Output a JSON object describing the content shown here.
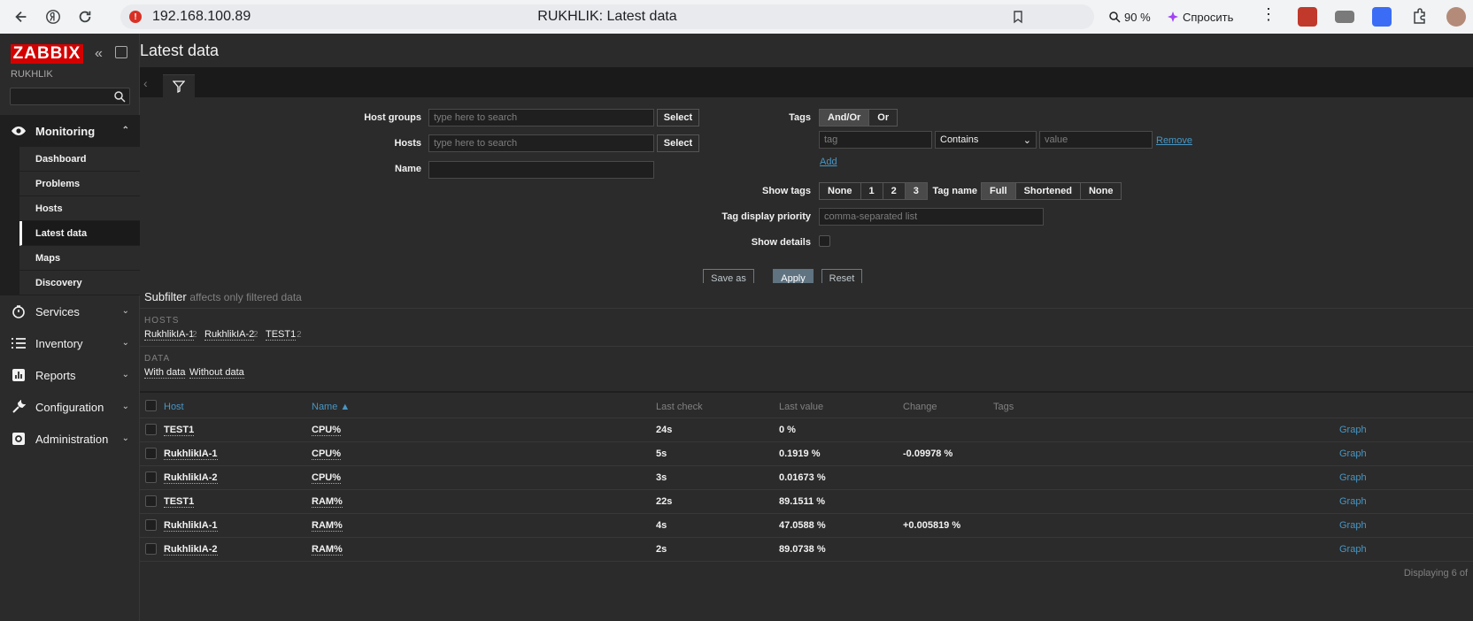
{
  "browser": {
    "url": "192.168.100.89",
    "title": "RUKHLIK: Latest data",
    "zoom": "90 %",
    "ask_label": "Спросить"
  },
  "sidebar": {
    "logo": "ZABBIX",
    "server": "RUKHLIK",
    "menu": [
      {
        "label": "Monitoring",
        "icon": "eye-icon",
        "open": true,
        "items": [
          "Dashboard",
          "Problems",
          "Hosts",
          "Latest data",
          "Maps",
          "Discovery"
        ],
        "active": "Latest data"
      },
      {
        "label": "Services",
        "icon": "stopwatch-icon"
      },
      {
        "label": "Inventory",
        "icon": "list-icon"
      },
      {
        "label": "Reports",
        "icon": "bar-chart-icon"
      },
      {
        "label": "Configuration",
        "icon": "wrench-icon"
      },
      {
        "label": "Administration",
        "icon": "gear-icon"
      }
    ]
  },
  "page": {
    "title": "Latest data"
  },
  "filter": {
    "host_groups_label": "Host groups",
    "host_groups_placeholder": "type here to search",
    "hosts_label": "Hosts",
    "hosts_placeholder": "type here to search",
    "name_label": "Name",
    "select_label": "Select",
    "tags_label": "Tags",
    "tags_andor": "And/Or",
    "tags_or": "Or",
    "tag_placeholder": "tag",
    "operator": "Contains",
    "value_placeholder": "value",
    "remove_label": "Remove",
    "add_label": "Add",
    "show_tags_label": "Show tags",
    "show_tags_options": [
      "None",
      "1",
      "2",
      "3"
    ],
    "show_tags_selected": "3",
    "tag_name_label": "Tag name",
    "tag_name_options": [
      "Full",
      "Shortened",
      "None"
    ],
    "tag_name_selected": "Full",
    "tag_priority_label": "Tag display priority",
    "tag_priority_placeholder": "comma-separated list",
    "show_details_label": "Show details",
    "save_as": "Save as",
    "apply": "Apply",
    "reset": "Reset"
  },
  "subfilter": {
    "title": "Subfilter",
    "note": "affects only filtered data",
    "hosts_caption": "HOSTS",
    "hosts": [
      {
        "name": "RukhlikIA-1",
        "count": "2"
      },
      {
        "name": "RukhlikIA-2",
        "count": "2"
      },
      {
        "name": "TEST1",
        "count": "2"
      }
    ],
    "data_caption": "DATA",
    "data": [
      "With data",
      "Without data"
    ]
  },
  "table": {
    "headers": {
      "host": "Host",
      "name": "Name ▲",
      "last_check": "Last check",
      "last_value": "Last value",
      "change": "Change",
      "tags": "Tags"
    },
    "rows": [
      {
        "host": "TEST1",
        "name": "CPU%",
        "last_check": "24s",
        "last_value": "0 %",
        "change": "",
        "graph": "Graph"
      },
      {
        "host": "RukhlikIA-1",
        "name": "CPU%",
        "last_check": "5s",
        "last_value": "0.1919 %",
        "change": "-0.09978 %",
        "graph": "Graph"
      },
      {
        "host": "RukhlikIA-2",
        "name": "CPU%",
        "last_check": "3s",
        "last_value": "0.01673 %",
        "change": "",
        "graph": "Graph"
      },
      {
        "host": "TEST1",
        "name": "RAM%",
        "last_check": "22s",
        "last_value": "89.1511 %",
        "change": "",
        "graph": "Graph"
      },
      {
        "host": "RukhlikIA-1",
        "name": "RAM%",
        "last_check": "4s",
        "last_value": "47.0588 %",
        "change": "+0.005819 %",
        "graph": "Graph"
      },
      {
        "host": "RukhlikIA-2",
        "name": "RAM%",
        "last_check": "2s",
        "last_value": "89.0738 %",
        "change": "",
        "graph": "Graph"
      }
    ],
    "footer": "Displaying 6 of"
  }
}
